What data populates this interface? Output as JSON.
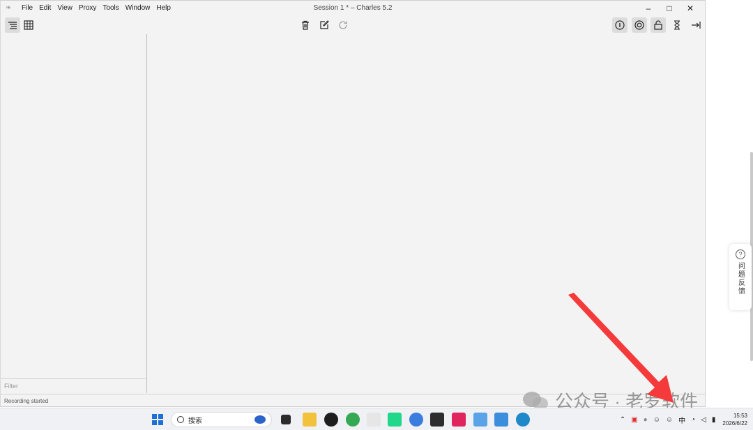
{
  "window": {
    "title": "Session 1 * – Charles 5.2",
    "menu": [
      "File",
      "Edit",
      "View",
      "Proxy",
      "Tools",
      "Window",
      "Help"
    ],
    "controls": {
      "minimize": "–",
      "maximize": "□",
      "close": "✕"
    }
  },
  "left_pane": {
    "filter_label": "Filter"
  },
  "status": {
    "text": "Recording started"
  },
  "feedback": {
    "icon": "?",
    "label": "问题反馈"
  },
  "watermark": {
    "text": "公众号 · 老罗软件"
  },
  "taskbar": {
    "search_placeholder": "搜索",
    "tray_lang": "中",
    "time": "15:53",
    "date": "2026/6/22"
  },
  "colors": {
    "arrow": "#f43a3a",
    "start": "#1f6fd6"
  }
}
